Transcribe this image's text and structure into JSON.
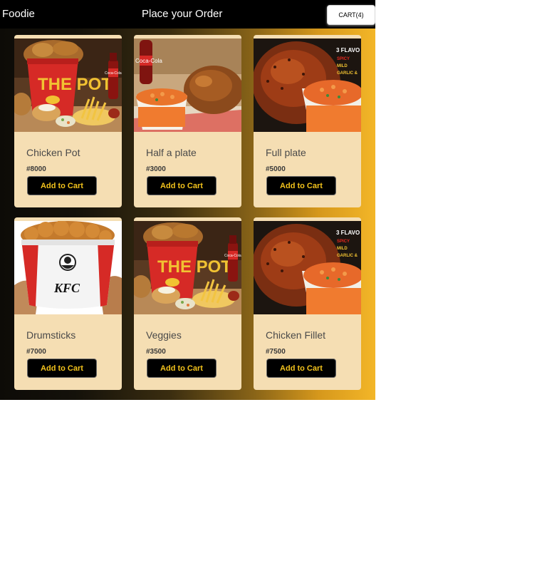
{
  "header": {
    "brand": "Foodie",
    "title": "Place your Order",
    "cart_label": "CART(4)"
  },
  "products": [
    {
      "name": "Chicken Pot",
      "price": "#8000",
      "button_label": "Add to Cart",
      "image": "chicken-pot-bucket-image"
    },
    {
      "name": "Half a plate",
      "price": "#3000",
      "button_label": "Add to Cart",
      "image": "half-plate-chicken-pasta-image"
    },
    {
      "name": "Full plate",
      "price": "#5000",
      "button_label": "Add to Cart",
      "image": "full-plate-chicken-pasta-image"
    },
    {
      "name": "Drumsticks",
      "price": "#7000",
      "button_label": "Add to Cart",
      "image": "kfc-bucket-image"
    },
    {
      "name": "Veggies",
      "price": "#3500",
      "button_label": "Add to Cart",
      "image": "chicken-pot-bucket-image"
    },
    {
      "name": "Chicken Fillet",
      "price": "#7500",
      "button_label": "Add to Cart",
      "image": "full-plate-chicken-pasta-image"
    }
  ],
  "image_text": {
    "pot_brand": "THE POT",
    "cola": "Coca-Cola",
    "kfc": "KFC",
    "flavours": "3 FLAVO",
    "spicy": "SPICY",
    "mild": "MILD",
    "garlic": "GARLIC &"
  },
  "colors": {
    "header_bg": "#000000",
    "card_bg": "#f5deb3",
    "button_bg": "#000000",
    "button_text": "#f2c21c",
    "gradient_end": "#f3b628"
  }
}
